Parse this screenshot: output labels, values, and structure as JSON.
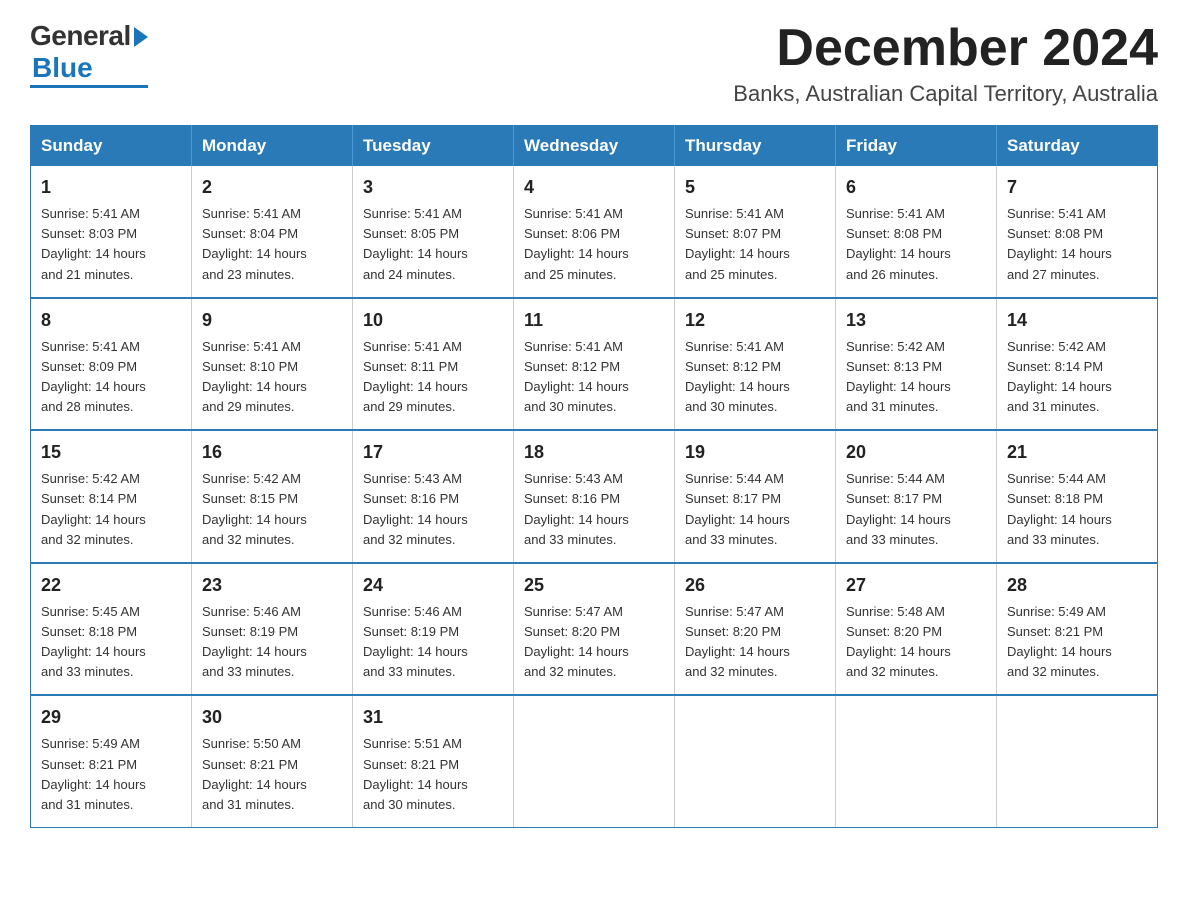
{
  "logo": {
    "general": "General",
    "blue": "Blue"
  },
  "title": {
    "month_year": "December 2024",
    "location": "Banks, Australian Capital Territory, Australia"
  },
  "days_of_week": [
    "Sunday",
    "Monday",
    "Tuesday",
    "Wednesday",
    "Thursday",
    "Friday",
    "Saturday"
  ],
  "weeks": [
    [
      {
        "day": "1",
        "sunrise": "5:41 AM",
        "sunset": "8:03 PM",
        "daylight": "14 hours and 21 minutes."
      },
      {
        "day": "2",
        "sunrise": "5:41 AM",
        "sunset": "8:04 PM",
        "daylight": "14 hours and 23 minutes."
      },
      {
        "day": "3",
        "sunrise": "5:41 AM",
        "sunset": "8:05 PM",
        "daylight": "14 hours and 24 minutes."
      },
      {
        "day": "4",
        "sunrise": "5:41 AM",
        "sunset": "8:06 PM",
        "daylight": "14 hours and 25 minutes."
      },
      {
        "day": "5",
        "sunrise": "5:41 AM",
        "sunset": "8:07 PM",
        "daylight": "14 hours and 25 minutes."
      },
      {
        "day": "6",
        "sunrise": "5:41 AM",
        "sunset": "8:08 PM",
        "daylight": "14 hours and 26 minutes."
      },
      {
        "day": "7",
        "sunrise": "5:41 AM",
        "sunset": "8:08 PM",
        "daylight": "14 hours and 27 minutes."
      }
    ],
    [
      {
        "day": "8",
        "sunrise": "5:41 AM",
        "sunset": "8:09 PM",
        "daylight": "14 hours and 28 minutes."
      },
      {
        "day": "9",
        "sunrise": "5:41 AM",
        "sunset": "8:10 PM",
        "daylight": "14 hours and 29 minutes."
      },
      {
        "day": "10",
        "sunrise": "5:41 AM",
        "sunset": "8:11 PM",
        "daylight": "14 hours and 29 minutes."
      },
      {
        "day": "11",
        "sunrise": "5:41 AM",
        "sunset": "8:12 PM",
        "daylight": "14 hours and 30 minutes."
      },
      {
        "day": "12",
        "sunrise": "5:41 AM",
        "sunset": "8:12 PM",
        "daylight": "14 hours and 30 minutes."
      },
      {
        "day": "13",
        "sunrise": "5:42 AM",
        "sunset": "8:13 PM",
        "daylight": "14 hours and 31 minutes."
      },
      {
        "day": "14",
        "sunrise": "5:42 AM",
        "sunset": "8:14 PM",
        "daylight": "14 hours and 31 minutes."
      }
    ],
    [
      {
        "day": "15",
        "sunrise": "5:42 AM",
        "sunset": "8:14 PM",
        "daylight": "14 hours and 32 minutes."
      },
      {
        "day": "16",
        "sunrise": "5:42 AM",
        "sunset": "8:15 PM",
        "daylight": "14 hours and 32 minutes."
      },
      {
        "day": "17",
        "sunrise": "5:43 AM",
        "sunset": "8:16 PM",
        "daylight": "14 hours and 32 minutes."
      },
      {
        "day": "18",
        "sunrise": "5:43 AM",
        "sunset": "8:16 PM",
        "daylight": "14 hours and 33 minutes."
      },
      {
        "day": "19",
        "sunrise": "5:44 AM",
        "sunset": "8:17 PM",
        "daylight": "14 hours and 33 minutes."
      },
      {
        "day": "20",
        "sunrise": "5:44 AM",
        "sunset": "8:17 PM",
        "daylight": "14 hours and 33 minutes."
      },
      {
        "day": "21",
        "sunrise": "5:44 AM",
        "sunset": "8:18 PM",
        "daylight": "14 hours and 33 minutes."
      }
    ],
    [
      {
        "day": "22",
        "sunrise": "5:45 AM",
        "sunset": "8:18 PM",
        "daylight": "14 hours and 33 minutes."
      },
      {
        "day": "23",
        "sunrise": "5:46 AM",
        "sunset": "8:19 PM",
        "daylight": "14 hours and 33 minutes."
      },
      {
        "day": "24",
        "sunrise": "5:46 AM",
        "sunset": "8:19 PM",
        "daylight": "14 hours and 33 minutes."
      },
      {
        "day": "25",
        "sunrise": "5:47 AM",
        "sunset": "8:20 PM",
        "daylight": "14 hours and 32 minutes."
      },
      {
        "day": "26",
        "sunrise": "5:47 AM",
        "sunset": "8:20 PM",
        "daylight": "14 hours and 32 minutes."
      },
      {
        "day": "27",
        "sunrise": "5:48 AM",
        "sunset": "8:20 PM",
        "daylight": "14 hours and 32 minutes."
      },
      {
        "day": "28",
        "sunrise": "5:49 AM",
        "sunset": "8:21 PM",
        "daylight": "14 hours and 32 minutes."
      }
    ],
    [
      {
        "day": "29",
        "sunrise": "5:49 AM",
        "sunset": "8:21 PM",
        "daylight": "14 hours and 31 minutes."
      },
      {
        "day": "30",
        "sunrise": "5:50 AM",
        "sunset": "8:21 PM",
        "daylight": "14 hours and 31 minutes."
      },
      {
        "day": "31",
        "sunrise": "5:51 AM",
        "sunset": "8:21 PM",
        "daylight": "14 hours and 30 minutes."
      },
      null,
      null,
      null,
      null
    ]
  ],
  "labels": {
    "sunrise": "Sunrise:",
    "sunset": "Sunset:",
    "daylight": "Daylight:"
  }
}
